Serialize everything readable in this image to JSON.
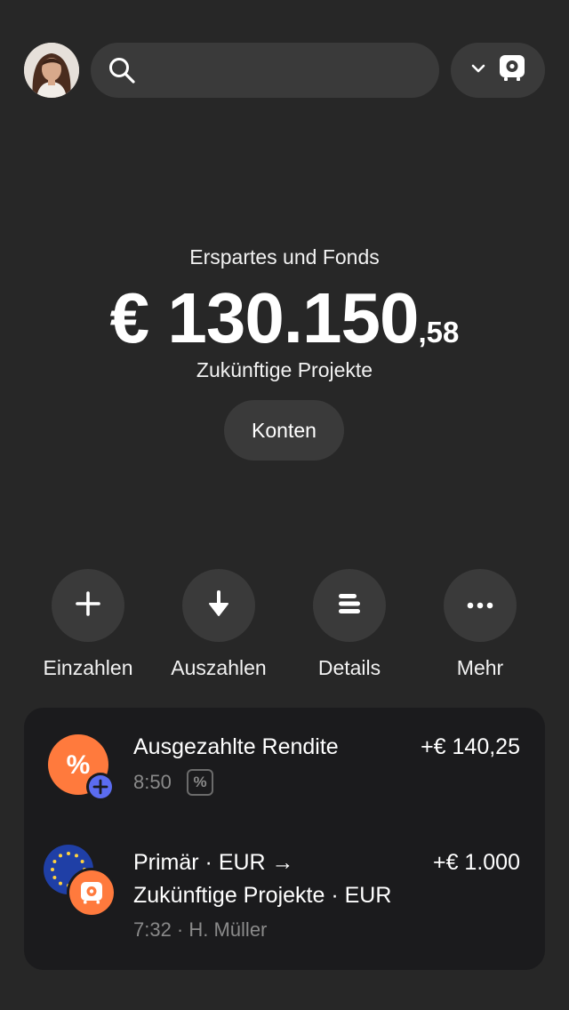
{
  "header": {
    "search_placeholder": "",
    "avatar_alt": "profile photo"
  },
  "balance": {
    "label": "Erspartes und Fonds",
    "main": "€ 130.150",
    "cents": ",58",
    "account_name": "Zukünftige Projekte",
    "accounts_button": "Konten"
  },
  "actions": [
    {
      "label": "Einzahlen",
      "icon": "plus-icon"
    },
    {
      "label": "Auszahlen",
      "icon": "arrow-down-icon"
    },
    {
      "label": "Details",
      "icon": "list-icon"
    },
    {
      "label": "Mehr",
      "icon": "more-dots-icon"
    }
  ],
  "transactions": [
    {
      "title": "Ausgezahlte Rendite",
      "amount": "+€ 140,25",
      "meta": "8:50",
      "badge": "%"
    },
    {
      "title_line1": "Primär · EUR →",
      "title_line2": "Zukünftige Projekte · EUR",
      "amount": "+€ 1.000",
      "meta": "7:32 · H. Müller"
    }
  ],
  "colors": {
    "background": "#272727",
    "surface": "#3a3a3a",
    "card": "#1b1b1d",
    "accent_orange": "#ff7a3d",
    "accent_blue": "#5b6cf0",
    "eu_blue": "#1f3fa6",
    "muted_text": "#8a8a8a"
  }
}
